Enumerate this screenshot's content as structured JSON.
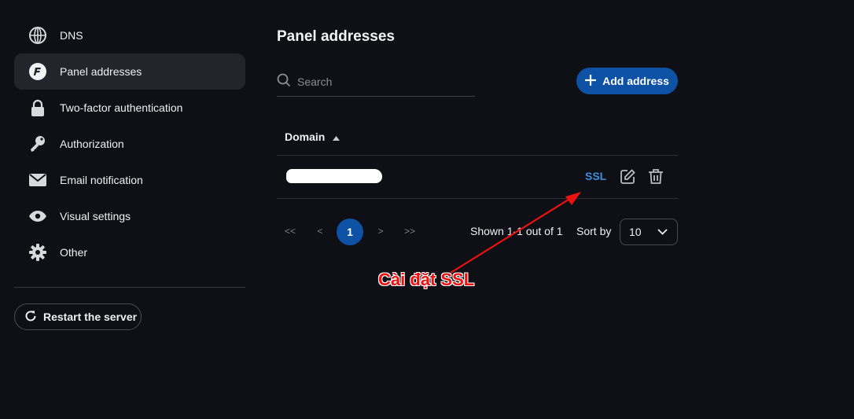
{
  "sidebar": {
    "items": [
      {
        "label": "DNS",
        "icon": "globe-icon"
      },
      {
        "label": "Panel addresses",
        "icon": "panel-logo-icon",
        "active": true
      },
      {
        "label": "Two-factor authentication",
        "icon": "lock-icon"
      },
      {
        "label": "Authorization",
        "icon": "key-icon"
      },
      {
        "label": "Email notification",
        "icon": "envelope-icon"
      },
      {
        "label": "Visual settings",
        "icon": "eye-icon"
      },
      {
        "label": "Other",
        "icon": "gear-icon"
      }
    ],
    "restart_label": "Restart the server"
  },
  "main": {
    "title": "Panel addresses",
    "search_placeholder": "Search",
    "add_label": "Add address",
    "table": {
      "column_domain": "Domain",
      "rows": [
        {
          "domain": "",
          "ssl_label": "SSL"
        }
      ]
    },
    "pagination": {
      "first": "<<",
      "prev": "<",
      "current": "1",
      "next": ">",
      "last": ">>",
      "shown": "Shown 1-1 out of 1",
      "sort_label": "Sort by",
      "sort_value": "10"
    }
  },
  "annotation": {
    "text": "Cài đặt SSL"
  },
  "colors": {
    "background": "#0f1015",
    "accent": "#0d52a5",
    "link": "#3d8fe0",
    "annotation": "#ee1111"
  }
}
